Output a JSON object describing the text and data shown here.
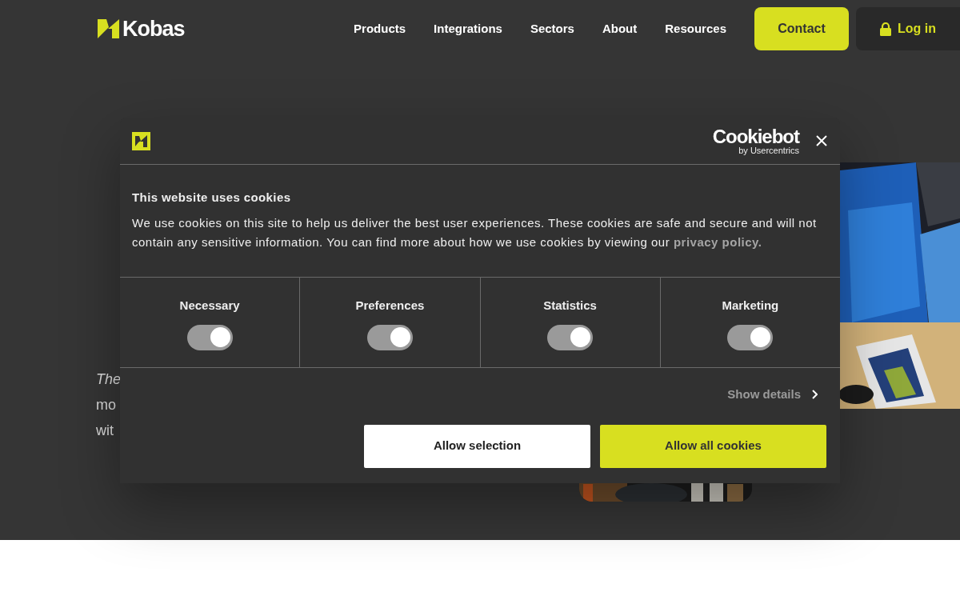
{
  "nav": {
    "brand": "Kobas",
    "links": [
      "Products",
      "Integrations",
      "Sectors",
      "About",
      "Resources"
    ],
    "contact": "Contact",
    "login": "Log in"
  },
  "hero": {
    "intro_lines": [
      {
        "text": "The",
        "italic": true
      },
      {
        "text": "mo",
        "italic": false
      },
      {
        "text": "wit",
        "italic": false
      }
    ]
  },
  "cookie_dialog": {
    "provider": "Cookiebot",
    "provider_sub": "by Usercentrics",
    "title": "This website uses cookies",
    "body": "We use cookies on this site to help us deliver the best user experiences. These cookies are safe and secure and will not contain any sensitive information. You can find more about how we use cookies by viewing our ",
    "link": "privacy policy.",
    "categories": [
      {
        "label": "Necessary",
        "checked": true
      },
      {
        "label": "Preferences",
        "checked": true
      },
      {
        "label": "Statistics",
        "checked": true
      },
      {
        "label": "Marketing",
        "checked": true
      }
    ],
    "show_details": "Show details",
    "buttons": [
      {
        "label": "Allow selection",
        "kind": "secondary"
      },
      {
        "label": "Allow all cookies",
        "kind": "primary"
      }
    ]
  }
}
